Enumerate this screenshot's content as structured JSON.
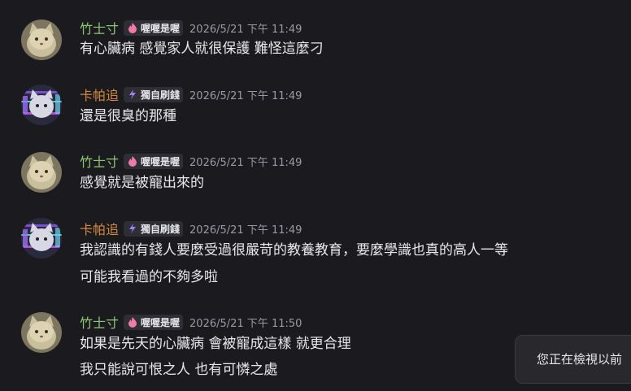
{
  "messages": [
    {
      "username": "竹士寸",
      "username_color": "#8cc873",
      "tag_label": "喔喔是喔",
      "tag_icon": "pink-flame-icon",
      "timestamp": "2026/5/21 下午 11:49",
      "avatar": "cat-avatar",
      "lines": [
        "有心臟病 感覺家人就很保護 難怪這麼刁"
      ]
    },
    {
      "username": "卡帕追",
      "username_color": "#d48a3c",
      "tag_label": "獨自刷錢",
      "tag_icon": "purple-lightning-icon",
      "timestamp": "2026/5/21 下午 11:49",
      "avatar": "purple-glitch-cat-avatar",
      "lines": [
        "還是很臭的那種"
      ]
    },
    {
      "username": "竹士寸",
      "username_color": "#8cc873",
      "tag_label": "喔喔是喔",
      "tag_icon": "pink-flame-icon",
      "timestamp": "2026/5/21 下午 11:49",
      "avatar": "cat-avatar",
      "lines": [
        "感覺就是被寵出來的"
      ]
    },
    {
      "username": "卡帕追",
      "username_color": "#d48a3c",
      "tag_label": "獨自刷錢",
      "tag_icon": "purple-lightning-icon",
      "timestamp": "2026/5/21 下午 11:49",
      "avatar": "purple-glitch-cat-avatar",
      "lines": [
        "我認識的有錢人要麼受過很嚴苛的教養教育，要麼學識也真的高人一等",
        "可能我看過的不夠多啦"
      ]
    },
    {
      "username": "竹士寸",
      "username_color": "#8cc873",
      "tag_label": "喔喔是喔",
      "tag_icon": "pink-flame-icon",
      "timestamp": "2026/5/21 下午 11:50",
      "avatar": "cat-avatar",
      "lines": [
        "如果是先天的心臟病 會被寵成這樣 就更合理",
        "我只能說可恨之人 也有可憐之處"
      ]
    }
  ],
  "toast": {
    "text": "您正在檢視以前"
  }
}
